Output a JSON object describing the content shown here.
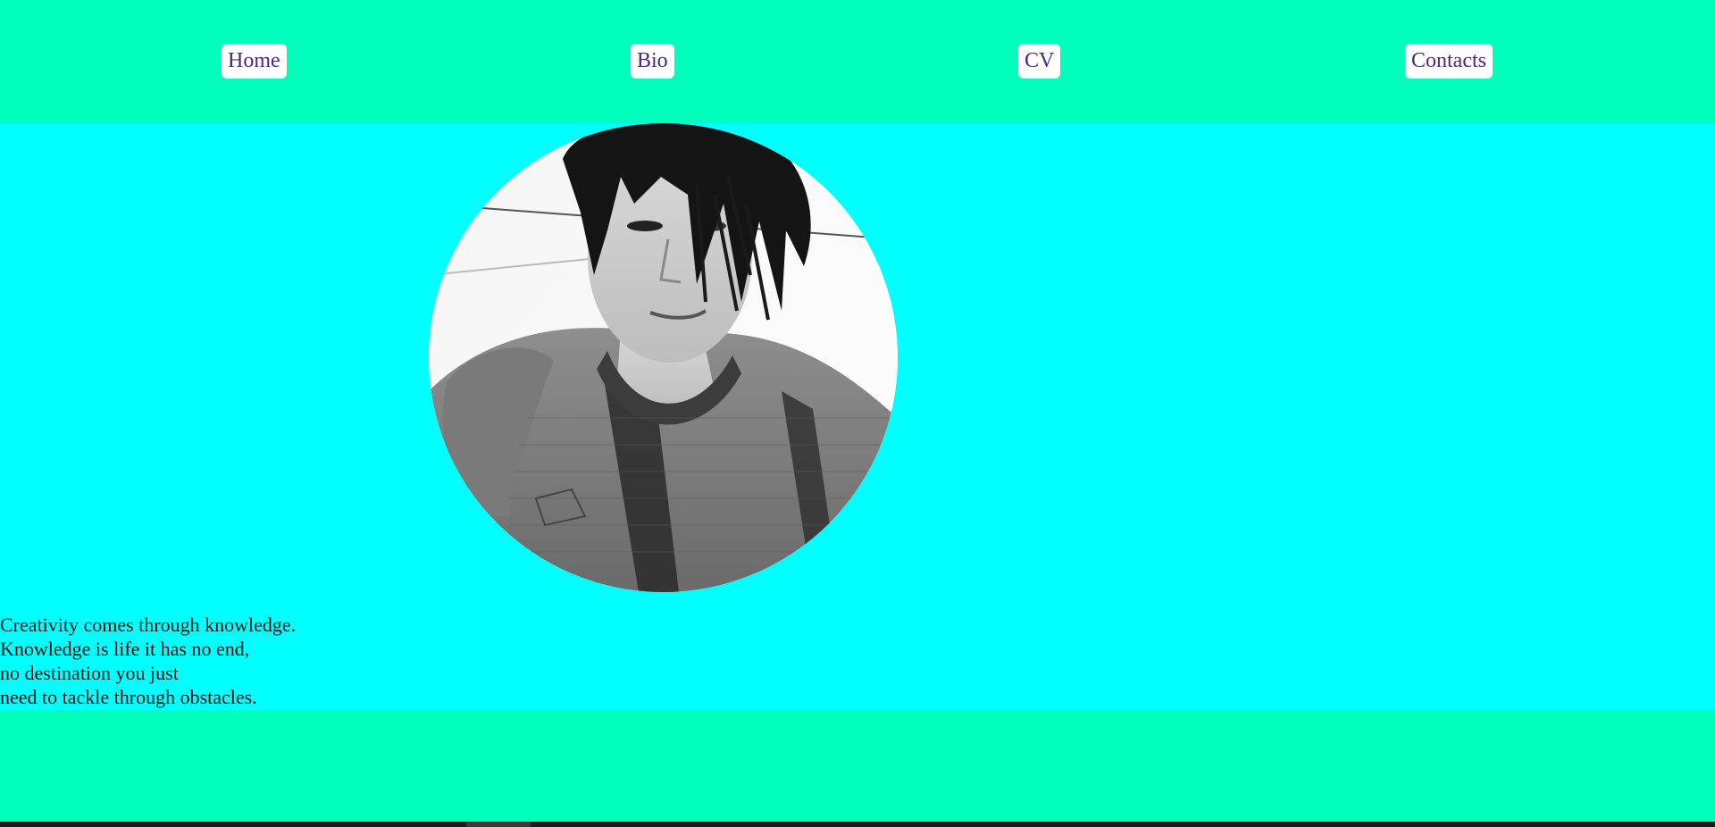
{
  "nav": {
    "home": "Home",
    "bio": "Bio",
    "cv": "CV",
    "contacts": "Contacts"
  },
  "quote": {
    "line1": "Creativity comes through knowledge.",
    "line2": "Knowledge is life it has no end,",
    "line3": "no destination you just",
    "line4": "need to tackle through obstacles."
  },
  "colors": {
    "header_bg": "#00ffbb",
    "main_bg": "#00ffff",
    "nav_text": "#4b2a7b",
    "nav_button_bg": "#ffffff"
  }
}
